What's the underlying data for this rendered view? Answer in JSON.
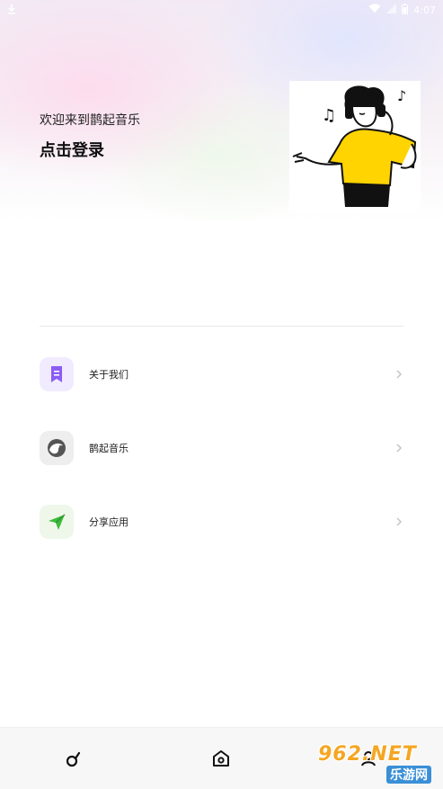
{
  "status_bar": {
    "time": "4:07",
    "left_icon": "download-icon",
    "right_icons": [
      "wifi-icon",
      "signal-icon",
      "battery-icon"
    ]
  },
  "header": {
    "greeting": "欢迎来到鹊起音乐",
    "login_text": "点击登录",
    "illustration": "music-listener-illustration"
  },
  "menu": {
    "items": [
      {
        "label": "关于我们",
        "icon": "bookmark-note-icon",
        "color": "#8b5cf6",
        "bg": "#f0ebff"
      },
      {
        "label": "鹊起音乐",
        "icon": "magpie-icon",
        "color": "#444444",
        "bg": "#eeeeee"
      },
      {
        "label": "分享应用",
        "icon": "send-plane-icon",
        "color": "#3dbb3d",
        "bg": "#eef7ea"
      }
    ]
  },
  "bottom_nav": {
    "items": [
      {
        "icon": "music-note-icon"
      },
      {
        "icon": "home-icon"
      },
      {
        "icon": "profile-icon"
      }
    ]
  },
  "watermark": {
    "top": "962.NET",
    "bottom": "乐游网"
  }
}
